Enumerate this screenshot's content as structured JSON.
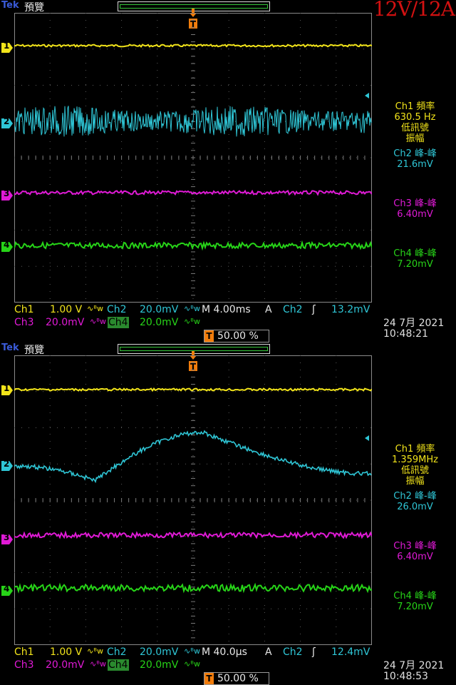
{
  "banner": "12V/12A",
  "colors": {
    "ch1": "#f2e41a",
    "ch2": "#2fc6d6",
    "ch3": "#e01ad6",
    "ch4": "#27d418",
    "trigger": "#f27d0c"
  },
  "screens": [
    {
      "brand": "Tek",
      "mode": "預覽",
      "trigger_icon": "T",
      "channels": [
        "1",
        "2",
        "3",
        "4"
      ],
      "meas": {
        "ch1_title": "Ch1 頻率",
        "ch1_value": "630.5 Hz",
        "ch1_note1": "低訊號",
        "ch1_note2": "振幅",
        "ch2_title": "Ch2 峰-峰",
        "ch2_value": "21.6mV",
        "ch3_title": "Ch3 峰-峰",
        "ch3_value": "6.40mV",
        "ch4_title": "Ch4 峰-峰",
        "ch4_value": "7.20mV"
      },
      "status": {
        "ch1_label": "Ch1",
        "ch1_scale": "1.00 V",
        "ch2_label": "Ch2",
        "ch2_scale": "20.0mV",
        "ch3_label": "Ch3",
        "ch3_scale": "20.0mV",
        "ch4_label": "Ch4",
        "ch4_scale": "20.0mV",
        "bw_symbol": "∿ᴮw",
        "timebase": "M 4.00ms",
        "trig_mode": "A",
        "trig_src": "Ch2",
        "trig_slope": "ʃ",
        "trig_level": "13.2mV",
        "trig_pos": "50.00 %",
        "date": "24 7月  2021",
        "time": "10:48:21"
      },
      "wave2": {
        "shape": "noise-band",
        "amplitude_mv": 21.6
      }
    },
    {
      "brand": "Tek",
      "mode": "預覽",
      "trigger_icon": "T",
      "channels": [
        "1",
        "2",
        "3",
        "4"
      ],
      "meas": {
        "ch1_title": "Ch1 頻率",
        "ch1_value": "1.359MHz",
        "ch1_note1": "低訊號",
        "ch1_note2": "振幅",
        "ch2_title": "Ch2 峰-峰",
        "ch2_value": "26.0mV",
        "ch3_title": "Ch3 峰-峰",
        "ch3_value": "6.40mV",
        "ch4_title": "Ch4 峰-峰",
        "ch4_value": "7.20mV"
      },
      "status": {
        "ch1_label": "Ch1",
        "ch1_scale": "1.00 V",
        "ch2_label": "Ch2",
        "ch2_scale": "20.0mV",
        "ch3_label": "Ch3",
        "ch3_scale": "20.0mV",
        "ch4_label": "Ch4",
        "ch4_scale": "20.0mV",
        "bw_symbol": "∿ᴮw",
        "timebase": "M 40.0µs",
        "trig_mode": "A",
        "trig_src": "Ch2",
        "trig_slope": "ʃ",
        "trig_level": "12.4mV",
        "trig_pos": "50.00 %",
        "date": "24 7月  2021",
        "time": "10:48:53"
      },
      "wave2": {
        "shape": "sine-hump",
        "amplitude_mv": 26.0
      }
    }
  ]
}
